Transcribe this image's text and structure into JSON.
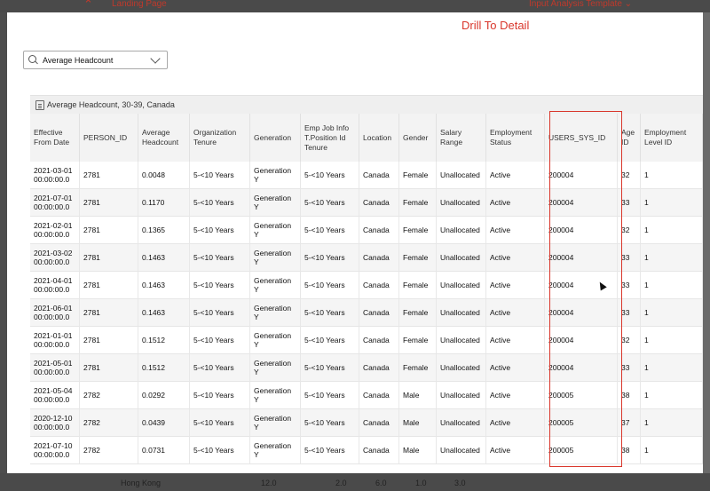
{
  "background": {
    "landing_label": "Landing Page",
    "template_label": "Input Analysis Template ⌄",
    "bottom_row": [
      "Hong Kong",
      "12.0",
      "2.0",
      "6.0",
      "1.0",
      "3.0"
    ]
  },
  "modal": {
    "title": "Drill To Detail",
    "measure_dropdown": {
      "value": "Average Headcount",
      "icon": "search-icon"
    },
    "table_title": "Average Headcount, 30-39, Canada",
    "highlight_color": "#d9362b",
    "columns": [
      "Effective From Date",
      "PERSON_ID",
      "Average Headcount",
      "Organization Tenure",
      "Generation",
      "Emp Job Info T.Position Id Tenure",
      "Location",
      "Gender",
      "Salary Range",
      "Employment Status",
      "USERS_SYS_ID",
      "Age ID",
      "Employment Level ID"
    ],
    "rows": [
      [
        "2021-03-01 00:00:00.0",
        "2781",
        "0.0048",
        "5-<10 Years",
        "Generation Y",
        "5-<10 Years",
        "Canada",
        "Female",
        "Unallocated",
        "Active",
        "200004",
        "32",
        "1"
      ],
      [
        "2021-07-01 00:00:00.0",
        "2781",
        "0.1170",
        "5-<10 Years",
        "Generation Y",
        "5-<10 Years",
        "Canada",
        "Female",
        "Unallocated",
        "Active",
        "200004",
        "33",
        "1"
      ],
      [
        "2021-02-01 00:00:00.0",
        "2781",
        "0.1365",
        "5-<10 Years",
        "Generation Y",
        "5-<10 Years",
        "Canada",
        "Female",
        "Unallocated",
        "Active",
        "200004",
        "32",
        "1"
      ],
      [
        "2021-03-02 00:00:00.0",
        "2781",
        "0.1463",
        "5-<10 Years",
        "Generation Y",
        "5-<10 Years",
        "Canada",
        "Female",
        "Unallocated",
        "Active",
        "200004",
        "33",
        "1"
      ],
      [
        "2021-04-01 00:00:00.0",
        "2781",
        "0.1463",
        "5-<10 Years",
        "Generation Y",
        "5-<10 Years",
        "Canada",
        "Female",
        "Unallocated",
        "Active",
        "200004",
        "33",
        "1"
      ],
      [
        "2021-06-01 00:00:00.0",
        "2781",
        "0.1463",
        "5-<10 Years",
        "Generation Y",
        "5-<10 Years",
        "Canada",
        "Female",
        "Unallocated",
        "Active",
        "200004",
        "33",
        "1"
      ],
      [
        "2021-01-01 00:00:00.0",
        "2781",
        "0.1512",
        "5-<10 Years",
        "Generation Y",
        "5-<10 Years",
        "Canada",
        "Female",
        "Unallocated",
        "Active",
        "200004",
        "32",
        "1"
      ],
      [
        "2021-05-01 00:00:00.0",
        "2781",
        "0.1512",
        "5-<10 Years",
        "Generation Y",
        "5-<10 Years",
        "Canada",
        "Female",
        "Unallocated",
        "Active",
        "200004",
        "33",
        "1"
      ],
      [
        "2021-05-04 00:00:00.0",
        "2782",
        "0.0292",
        "5-<10 Years",
        "Generation Y",
        "5-<10 Years",
        "Canada",
        "Male",
        "Unallocated",
        "Active",
        "200005",
        "38",
        "1"
      ],
      [
        "2020-12-10 00:00:00.0",
        "2782",
        "0.0439",
        "5-<10 Years",
        "Generation Y",
        "5-<10 Years",
        "Canada",
        "Male",
        "Unallocated",
        "Active",
        "200005",
        "37",
        "1"
      ],
      [
        "2021-07-10 00:00:00.0",
        "2782",
        "0.0731",
        "5-<10 Years",
        "Generation Y",
        "5-<10 Years",
        "Canada",
        "Male",
        "Unallocated",
        "Active",
        "200005",
        "38",
        "1"
      ]
    ]
  }
}
